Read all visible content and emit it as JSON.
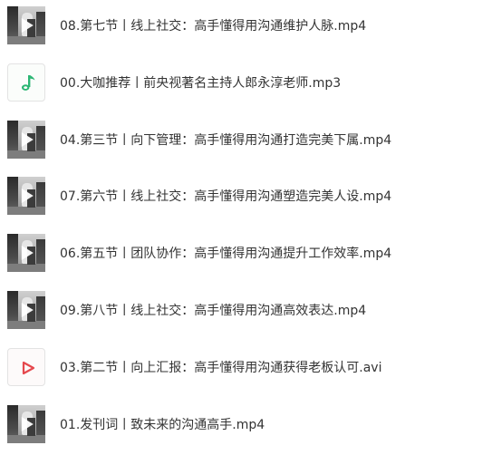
{
  "files": [
    {
      "name": "08.第七节丨线上社交：高手懂得用沟通维护人脉.mp4",
      "type": "video"
    },
    {
      "name": "00.大咖推荐丨前央视著名主持人郎永淳老师.mp3",
      "type": "audio"
    },
    {
      "name": "04.第三节丨向下管理：高手懂得用沟通打造完美下属.mp4",
      "type": "video"
    },
    {
      "name": "07.第六节丨线上社交：高手懂得用沟通塑造完美人设.mp4",
      "type": "video"
    },
    {
      "name": "06.第五节丨团队协作：高手懂得用沟通提升工作效率.mp4",
      "type": "video"
    },
    {
      "name": "09.第八节丨线上社交：高手懂得用沟通高效表达.mp4",
      "type": "video"
    },
    {
      "name": "03.第二节丨向上汇报：高手懂得用沟通获得老板认可.avi",
      "type": "avi"
    },
    {
      "name": "01.发刊词丨致未来的沟通高手.mp4",
      "type": "video"
    }
  ],
  "icons": {
    "video": "video-thumbnail-icon",
    "audio": "music-note-icon",
    "avi": "play-triangle-icon"
  },
  "colors": {
    "audio_icon": "#2bb673",
    "avi_icon": "#e5484d",
    "text": "#333333"
  }
}
